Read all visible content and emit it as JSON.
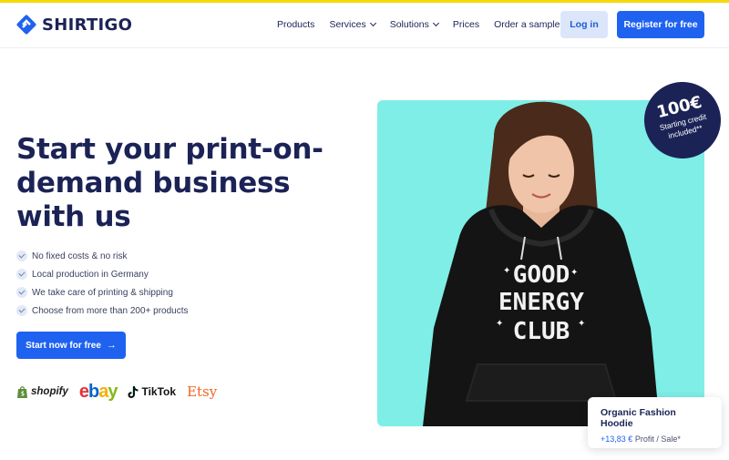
{
  "header": {
    "logo_text": "SHIRTIGO",
    "nav": [
      {
        "label": "Products",
        "dropdown": false
      },
      {
        "label": "Services",
        "dropdown": true
      },
      {
        "label": "Solutions",
        "dropdown": true
      },
      {
        "label": "Prices",
        "dropdown": false
      },
      {
        "label": "Order a sample",
        "dropdown": false
      }
    ],
    "login_label": "Log in",
    "register_label": "Register for free"
  },
  "hero": {
    "title": "Start your print-on-demand business with us",
    "features": [
      "No fixed costs & no risk",
      "Local production in Germany",
      "We take care of printing & shipping",
      "Choose from more than 200+ products"
    ],
    "cta_label": "Start now for free",
    "cta_arrow": "→"
  },
  "marketplaces": {
    "shopify": "shopify",
    "ebay": [
      "e",
      "b",
      "a",
      "y"
    ],
    "tiktok": "TikTok",
    "etsy": "Etsy"
  },
  "badge": {
    "amount": "100€",
    "line1": "Starting credit",
    "line2": "included**"
  },
  "product_card": {
    "name": "Organic Fashion Hoodie",
    "profit": "+13,83 €",
    "suffix": "Profit / Sale*"
  },
  "hoodie_print": [
    "GOOD",
    "ENERGY",
    "CLUB"
  ],
  "colors": {
    "brand_blue": "#1f62f0",
    "navy": "#1b2356",
    "photo_bg": "#7eeee6",
    "top_accent": "#f5d90a"
  },
  "icons": {
    "logo": "shirtigo-logo-icon",
    "check": "check-icon",
    "arrow": "arrow-right-icon"
  }
}
